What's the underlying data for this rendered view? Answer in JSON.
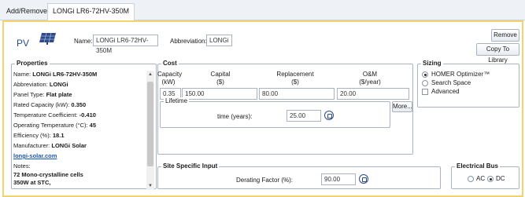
{
  "tabs": {
    "add_remove": "Add/Remove",
    "active": "LONGi LR6-72HV-350M"
  },
  "header": {
    "pv_label": "PV",
    "name_label": "Name:",
    "name_value": "LONGi LR6-72HV-350M",
    "abbreviation_label": "Abbreviation:",
    "abbreviation_value": "LONGi",
    "remove_button": "Remove",
    "copy_button": "Copy To Library"
  },
  "properties": {
    "title": "Properties",
    "name_label": "Name:",
    "name_value": "LONGi LR6-72HV-350M",
    "abbreviation_label": "Abbreviation:",
    "abbreviation_value": "LONGi",
    "panel_type_label": "Panel Type:",
    "panel_type_value": "Flat plate",
    "rated_capacity_label": "Rated Capacity (kW):",
    "rated_capacity_value": "0.350",
    "temp_coeff_label": "Temperature Coefficient:",
    "temp_coeff_value": "-0.410",
    "op_temp_label": "Operating Temperature (°C):",
    "op_temp_value": "45",
    "efficiency_label": "Efficiency (%):",
    "efficiency_value": "18.1",
    "manufacturer_label": "Manufacturer:",
    "manufacturer_value": "LONGi Solar",
    "website": "longi-solar.com",
    "notes_label": "Notes:",
    "notes_line1": "72 Mono-crystalline cells",
    "notes_line2": "350W at STC,"
  },
  "cost": {
    "title": "Cost",
    "capacity_head1": "Capacity",
    "capacity_head2": "(kW)",
    "capital_head1": "Capital",
    "capital_head2": "($)",
    "replacement_head1": "Replacement",
    "replacement_head2": "($)",
    "om_head1": "O&M",
    "om_head2": "($/year)",
    "capacity_value": "0.35",
    "capital_value": "150.00",
    "replacement_value": "80.00",
    "om_value": "20.00",
    "more_button": "More...",
    "lifetime_title": "Lifetime",
    "time_label": "time (years):",
    "time_value": "25.00"
  },
  "sizing": {
    "title": "Sizing",
    "homer_optimizer": "HOMER Optimizer™",
    "search_space": "Search Space",
    "advanced": "Advanced"
  },
  "site_input": {
    "title": "Site Specific Input",
    "derating_label": "Derating Factor (%):",
    "derating_value": "90.00"
  },
  "electrical_bus": {
    "title": "Electrical Bus",
    "ac": "AC",
    "dc": "DC"
  },
  "colors": {
    "panel_border": "#f5d36b",
    "pv_blue": "#2c4a8a",
    "link": "#1a56b3"
  }
}
